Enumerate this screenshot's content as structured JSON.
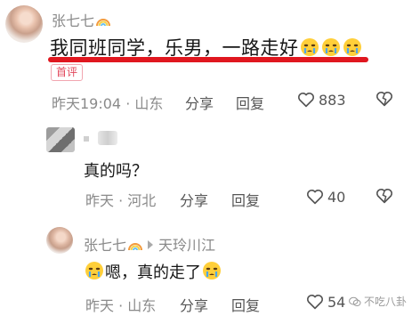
{
  "comment1": {
    "username": "张七七",
    "text": "我同班同学，乐男，一路走好",
    "badge": "首评",
    "time_location": "昨天19:04 · 山东",
    "share": "分享",
    "reply": "回复",
    "likes": "883"
  },
  "comment2": {
    "text": "真的吗？",
    "time_location": "昨天 · 河北",
    "share": "分享",
    "reply": "回复",
    "likes": "40"
  },
  "comment3": {
    "username": "张七七",
    "reply_to": "天玲川江",
    "text": "嗯，真的走了",
    "time_location": "昨天 · 山东",
    "share": "分享",
    "reply": "回复",
    "likes": "54"
  },
  "watermark": "不吃八卦",
  "colors": {
    "underline": "#e0171f",
    "badge": "#e2475b",
    "meta": "#8a8a8a"
  }
}
